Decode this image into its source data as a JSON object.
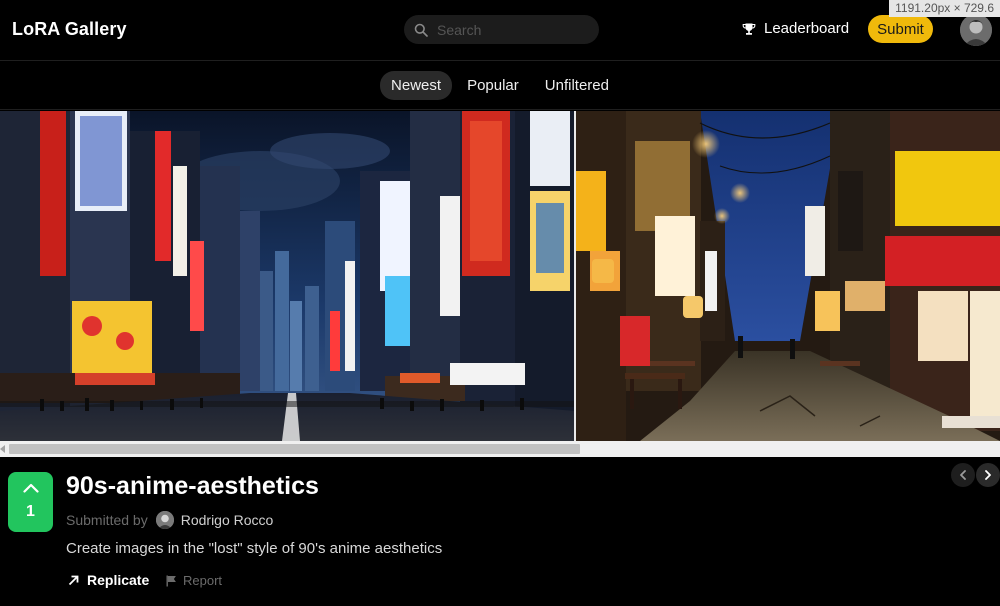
{
  "viewport_badge": "1191.20px × 729.6",
  "header": {
    "brand": "LoRA Gallery",
    "search_placeholder": "Search",
    "leaderboard_label": "Leaderboard",
    "submit_label": "Submit"
  },
  "tabs": [
    {
      "label": "Newest",
      "active": true
    },
    {
      "label": "Popular",
      "active": false
    },
    {
      "label": "Unfiltered",
      "active": false
    }
  ],
  "gallery": {
    "images": [
      "city-street-image",
      "alley-street-image"
    ]
  },
  "post": {
    "votes": "1",
    "title": "90s-anime-aesthetics",
    "submitted_by_label": "Submitted by",
    "author": "Rodrigo Rocco",
    "description": "Create images in the \"lost\" style of 90's anime aesthetics",
    "replicate_label": "Replicate",
    "report_label": "Report"
  },
  "colors": {
    "accent": "#f0b90b",
    "upvote": "#22c55e",
    "background": "#000000"
  },
  "icons": {
    "search": "search-icon",
    "leaderboard": "trophy-icon",
    "upvote": "chevron-up-icon",
    "replicate": "arrow-up-right-icon",
    "report": "flag-icon",
    "prev": "chevron-left-icon",
    "next": "chevron-right-icon"
  }
}
